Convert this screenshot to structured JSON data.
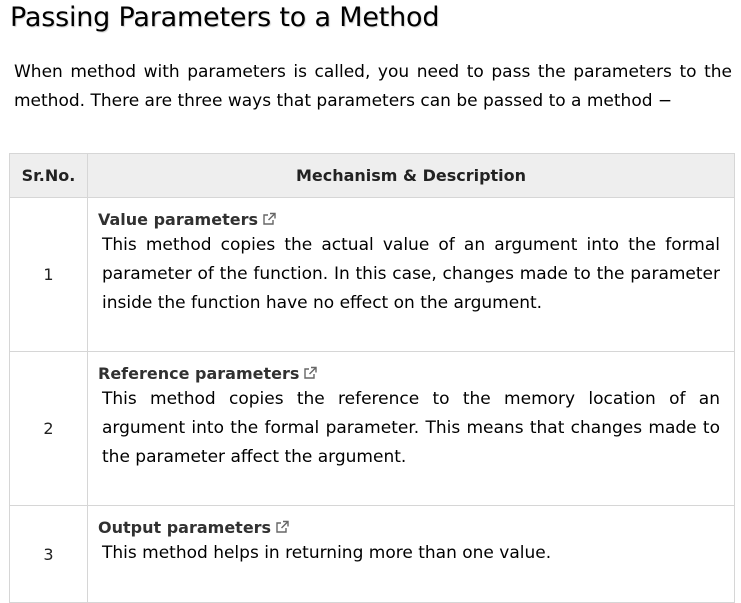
{
  "heading": "Passing Parameters to a Method",
  "intro": "When method with parameters is called, you need to pass the parameters to the method. There are three ways that parameters can be passed to a method −",
  "table": {
    "headers": {
      "srno": "Sr.No.",
      "mechanism": "Mechanism & Description"
    },
    "rows": [
      {
        "srno": "1",
        "name": "Value parameters",
        "description": "This method copies the actual value of an argument into the formal parameter of the function. In this case, changes made to the parameter inside the function have no effect on the argument."
      },
      {
        "srno": "2",
        "name": "Reference parameters",
        "description": "This method copies the reference to the memory location of an argument into the formal parameter. This means that changes made to the parameter affect the argument."
      },
      {
        "srno": "3",
        "name": "Output parameters",
        "description": "This method helps in returning more than one value."
      }
    ]
  },
  "icons": {
    "link": "external-link-icon"
  },
  "colors": {
    "header_bg": "#eeeeee",
    "border": "#d6d6d6",
    "icon": "#666666"
  }
}
